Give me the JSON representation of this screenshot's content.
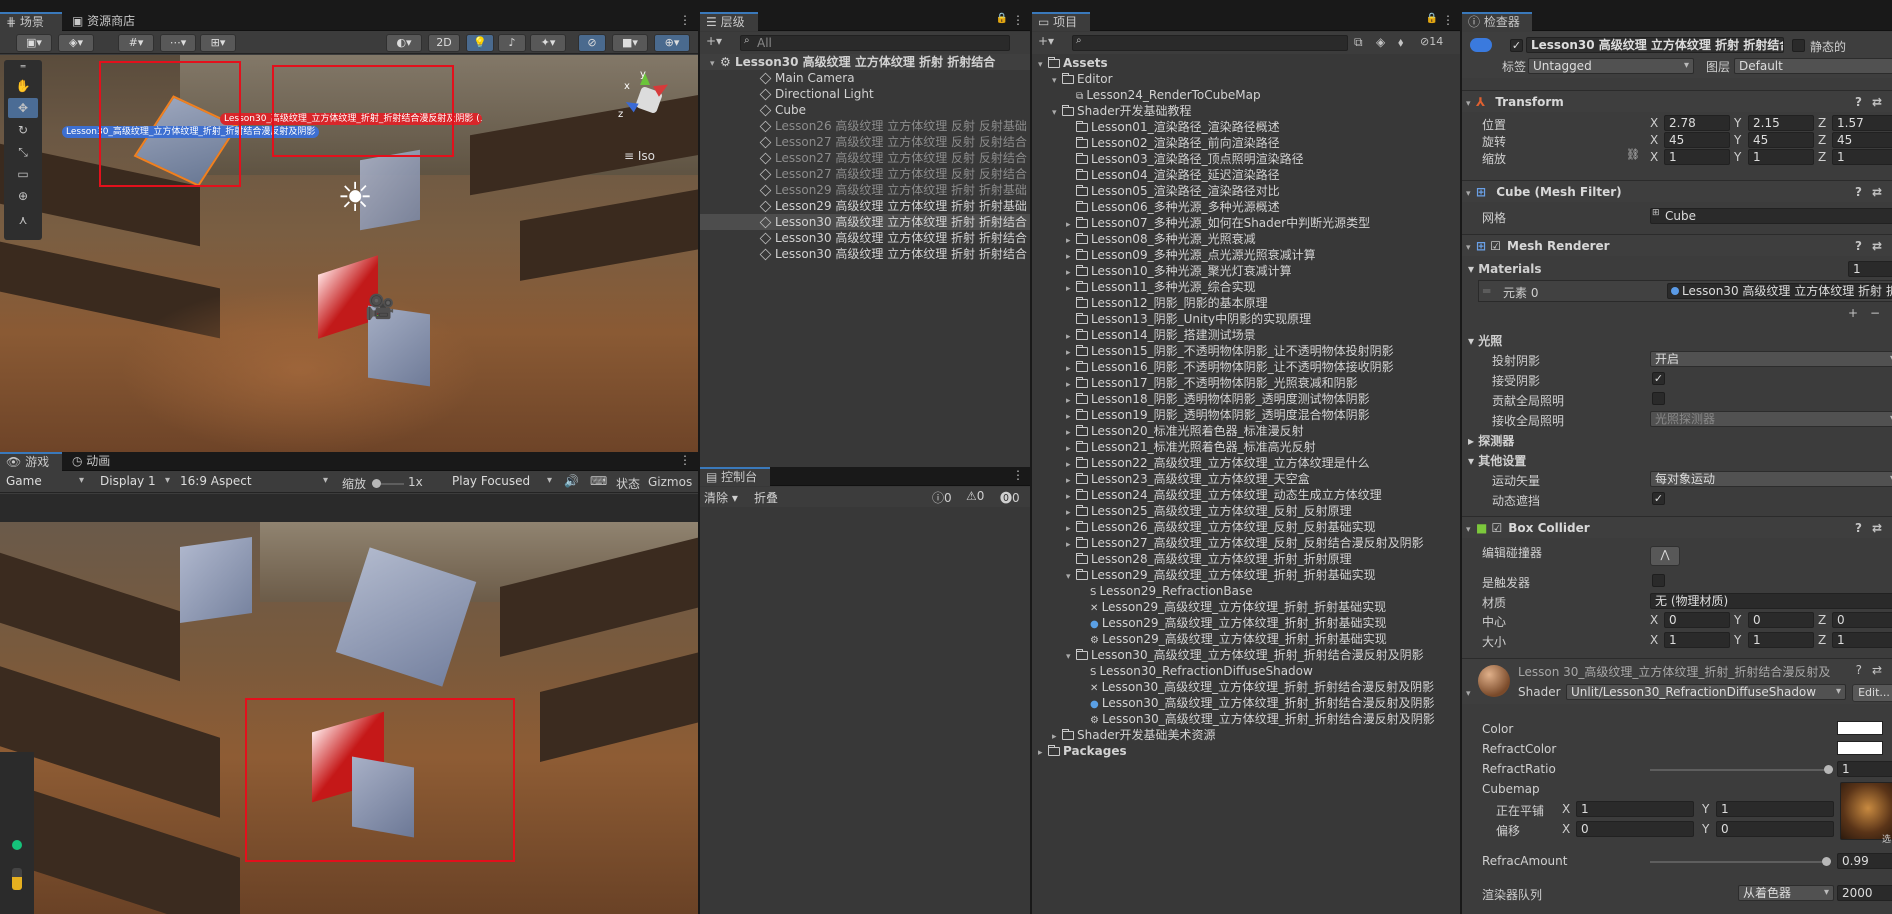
{
  "scene_panel": {
    "tabs": [
      {
        "label": "场景"
      },
      {
        "label": "资源商店"
      }
    ],
    "toggle_2d": "2D",
    "iso_label": "Iso",
    "object_label_1": "Lesson30_高级纹理_立方体纹理_折射_折射结合漫反射及阴影",
    "object_label_2": "Lesson30_高级纹理_立方体纹理_折射_折射结合漫反射及阴影 (1)"
  },
  "game_panel": {
    "tabs": [
      {
        "label": "游戏"
      },
      {
        "label": "动画"
      }
    ],
    "game_dropdown": "Game",
    "display_dropdown": "Display 1",
    "aspect_dropdown": "16:9 Aspect",
    "scale_label": "缩放",
    "scale_value": "1x",
    "play_mode": "Play Focused",
    "stats_label": "状态",
    "gizmos_label": "Gizmos"
  },
  "hierarchy": {
    "tab": "层级",
    "search_placeholder": "All",
    "scene_root": "Lesson30 高级纹理 立方体纹理 折射 折射结合",
    "items": [
      {
        "label": "Main Camera",
        "dim": false
      },
      {
        "label": "Directional Light",
        "dim": false
      },
      {
        "label": "Cube",
        "dim": false
      },
      {
        "label": "Lesson26 高级纹理 立方体纹理 反射 反射基础",
        "dim": true
      },
      {
        "label": "Lesson27 高级纹理 立方体纹理 反射 反射结合",
        "dim": true
      },
      {
        "label": "Lesson27 高级纹理 立方体纹理 反射 反射结合",
        "dim": true
      },
      {
        "label": "Lesson27 高级纹理 立方体纹理 反射 反射结合",
        "dim": true
      },
      {
        "label": "Lesson29 高级纹理 立方体纹理 折射 折射基础",
        "dim": true
      },
      {
        "label": "Lesson29 高级纹理 立方体纹理 折射 折射基础",
        "dim": false
      },
      {
        "label": "Lesson30 高级纹理 立方体纹理 折射 折射结合",
        "dim": false,
        "selected": true
      },
      {
        "label": "Lesson30 高级纹理 立方体纹理 折射 折射结合",
        "dim": false
      },
      {
        "label": "Lesson30 高级纹理 立方体纹理 折射 折射结合",
        "dim": false
      }
    ]
  },
  "console": {
    "tab": "控制台",
    "clear": "清除",
    "collapse": "折叠",
    "log_count": "0",
    "warn_count": "0",
    "error_count": "0"
  },
  "project": {
    "tab": "项目",
    "hidden_count": "14",
    "tree": [
      {
        "label": "Assets",
        "depth": 0,
        "arrow": "▾",
        "type": "folder",
        "bold": true
      },
      {
        "label": "Editor",
        "depth": 1,
        "arrow": "▾",
        "type": "folder"
      },
      {
        "label": "Lesson24_RenderToCubeMap",
        "depth": 2,
        "arrow": "",
        "type": "script"
      },
      {
        "label": "Shader开发基础教程",
        "depth": 1,
        "arrow": "▾",
        "type": "folder"
      },
      {
        "label": "Lesson01_渲染路径_渲染路径概述",
        "depth": 2,
        "arrow": "",
        "type": "folder"
      },
      {
        "label": "Lesson02_渲染路径_前向渲染路径",
        "depth": 2,
        "arrow": "",
        "type": "folder"
      },
      {
        "label": "Lesson03_渲染路径_顶点照明渲染路径",
        "depth": 2,
        "arrow": "",
        "type": "folder"
      },
      {
        "label": "Lesson04_渲染路径_延迟渲染路径",
        "depth": 2,
        "arrow": "",
        "type": "folder"
      },
      {
        "label": "Lesson05_渲染路径_渲染路径对比",
        "depth": 2,
        "arrow": "",
        "type": "folder"
      },
      {
        "label": "Lesson06_多种光源_多种光源概述",
        "depth": 2,
        "arrow": "",
        "type": "folder"
      },
      {
        "label": "Lesson07_多种光源_如何在Shader中判断光源类型",
        "depth": 2,
        "arrow": "▸",
        "type": "folder"
      },
      {
        "label": "Lesson08_多种光源_光照衰减",
        "depth": 2,
        "arrow": "▸",
        "type": "folder"
      },
      {
        "label": "Lesson09_多种光源_点光源光照衰减计算",
        "depth": 2,
        "arrow": "▸",
        "type": "folder"
      },
      {
        "label": "Lesson10_多种光源_聚光灯衰减计算",
        "depth": 2,
        "arrow": "▸",
        "type": "folder"
      },
      {
        "label": "Lesson11_多种光源_综合实现",
        "depth": 2,
        "arrow": "▸",
        "type": "folder"
      },
      {
        "label": "Lesson12_阴影_阴影的基本原理",
        "depth": 2,
        "arrow": "",
        "type": "folder"
      },
      {
        "label": "Lesson13_阴影_Unity中阴影的实现原理",
        "depth": 2,
        "arrow": "",
        "type": "folder"
      },
      {
        "label": "Lesson14_阴影_搭建测试场景",
        "depth": 2,
        "arrow": "▸",
        "type": "folder"
      },
      {
        "label": "Lesson15_阴影_不透明物体阴影_让不透明物体投射阴影",
        "depth": 2,
        "arrow": "▸",
        "type": "folder"
      },
      {
        "label": "Lesson16_阴影_不透明物体阴影_让不透明物体接收阴影",
        "depth": 2,
        "arrow": "▸",
        "type": "folder"
      },
      {
        "label": "Lesson17_阴影_不透明物体阴影_光照衰减和阴影",
        "depth": 2,
        "arrow": "▸",
        "type": "folder"
      },
      {
        "label": "Lesson18_阴影_透明物体阴影_透明度测试物体阴影",
        "depth": 2,
        "arrow": "▸",
        "type": "folder"
      },
      {
        "label": "Lesson19_阴影_透明物体阴影_透明度混合物体阴影",
        "depth": 2,
        "arrow": "▸",
        "type": "folder"
      },
      {
        "label": "Lesson20_标准光照着色器_标准漫反射",
        "depth": 2,
        "arrow": "▸",
        "type": "folder"
      },
      {
        "label": "Lesson21_标准光照着色器_标准高光反射",
        "depth": 2,
        "arrow": "▸",
        "type": "folder"
      },
      {
        "label": "Lesson22_高级纹理_立方体纹理_立方体纹理是什么",
        "depth": 2,
        "arrow": "▸",
        "type": "folder"
      },
      {
        "label": "Lesson23_高级纹理_立方体纹理_天空盒",
        "depth": 2,
        "arrow": "▸",
        "type": "folder"
      },
      {
        "label": "Lesson24_高级纹理_立方体纹理_动态生成立方体纹理",
        "depth": 2,
        "arrow": "▸",
        "type": "folder"
      },
      {
        "label": "Lesson25_高级纹理_立方体纹理_反射_反射原理",
        "depth": 2,
        "arrow": "▸",
        "type": "folder"
      },
      {
        "label": "Lesson26_高级纹理_立方体纹理_反射_反射基础实现",
        "depth": 2,
        "arrow": "▸",
        "type": "folder"
      },
      {
        "label": "Lesson27_高级纹理_立方体纹理_反射_反射结合漫反射及阴影",
        "depth": 2,
        "arrow": "▸",
        "type": "folder"
      },
      {
        "label": "Lesson28_高级纹理_立方体纹理_折射_折射原理",
        "depth": 2,
        "arrow": "",
        "type": "folder"
      },
      {
        "label": "Lesson29_高级纹理_立方体纹理_折射_折射基础实现",
        "depth": 2,
        "arrow": "▾",
        "type": "folder"
      },
      {
        "label": "Lesson29_RefractionBase",
        "depth": 3,
        "arrow": "",
        "type": "shader"
      },
      {
        "label": "Lesson29_高级纹理_立方体纹理_折射_折射基础实现",
        "depth": 3,
        "arrow": "",
        "type": "cubemap"
      },
      {
        "label": "Lesson29_高级纹理_立方体纹理_折射_折射基础实现",
        "depth": 3,
        "arrow": "",
        "type": "material"
      },
      {
        "label": "Lesson29_高级纹理_立方体纹理_折射_折射基础实现",
        "depth": 3,
        "arrow": "",
        "type": "scene"
      },
      {
        "label": "Lesson30_高级纹理_立方体纹理_折射_折射结合漫反射及阴影",
        "depth": 2,
        "arrow": "▾",
        "type": "folder"
      },
      {
        "label": "Lesson30_RefractionDiffuseShadow",
        "depth": 3,
        "arrow": "",
        "type": "shader"
      },
      {
        "label": "Lesson30_高级纹理_立方体纹理_折射_折射结合漫反射及阴影",
        "depth": 3,
        "arrow": "",
        "type": "cubemap"
      },
      {
        "label": "Lesson30_高级纹理_立方体纹理_折射_折射结合漫反射及阴影",
        "depth": 3,
        "arrow": "",
        "type": "material"
      },
      {
        "label": "Lesson30_高级纹理_立方体纹理_折射_折射结合漫反射及阴影",
        "depth": 3,
        "arrow": "",
        "type": "scene"
      },
      {
        "label": "Shader开发基础美术资源",
        "depth": 1,
        "arrow": "▸",
        "type": "folder"
      },
      {
        "label": "Packages",
        "depth": 0,
        "arrow": "▸",
        "type": "folder",
        "bold": true
      }
    ]
  },
  "inspector": {
    "tab": "检查器",
    "object_name": "Lesson30 高级纹理 立方体纹理 折射 折射结合漫反射",
    "static_label": "静态的",
    "tag_label": "标签",
    "tag_value": "Untagged",
    "layer_label": "图层",
    "layer_value": "Default",
    "transform": {
      "title": "Transform",
      "position_label": "位置",
      "position": [
        "2.78",
        "2.15",
        "1.57"
      ],
      "rotation_label": "旋转",
      "rotation": [
        "45",
        "45",
        "45"
      ],
      "scale_label": "缩放",
      "scale": [
        "1",
        "1",
        "1"
      ]
    },
    "mesh_filter": {
      "title": "Cube (Mesh Filter)",
      "mesh_label": "网格",
      "mesh_value": "Cube"
    },
    "mesh_renderer": {
      "title": "Mesh Renderer",
      "materials_label": "Materials",
      "materials_count": "1",
      "element_label": "元素 0",
      "element_value": "Lesson30 高级纹理 立方体纹理 折射 折",
      "lighting_label": "光照",
      "cast_shadows_label": "投射阴影",
      "cast_shadows_value": "开启",
      "receive_shadows_label": "接受阴影",
      "contribute_gi_label": "贡献全局照明",
      "receive_gi_label": "接收全局照明",
      "receive_gi_value": "光照探测器",
      "probes_label": "探测器",
      "additional_label": "其他设置",
      "motion_vectors_label": "运动矢量",
      "motion_vectors_value": "每对象运动",
      "dynamic_occlusion_label": "动态遮挡"
    },
    "box_collider": {
      "title": "Box Collider",
      "edit_label": "编辑碰撞器",
      "trigger_label": "是触发器",
      "material_label": "材质",
      "material_value": "无 (物理材质)",
      "center_label": "中心",
      "center": [
        "0",
        "0",
        "0"
      ],
      "size_label": "大小",
      "size": [
        "1",
        "1",
        "1"
      ]
    },
    "material": {
      "title": "Lesson 30_高级纹理_立方体纹理_折射_折射结合漫反射及",
      "shader_label": "Shader",
      "shader_value": "Unlit/Lesson30_RefractionDiffuseShadow",
      "edit_button": "Edit...",
      "color_label": "Color",
      "refract_color_label": "RefractColor",
      "refract_ratio_label": "RefractRatio",
      "refract_ratio_value": "1",
      "cubemap_label": "Cubemap",
      "tiling_label": "正在平铺",
      "tiling": [
        "1",
        "1"
      ],
      "offset_label": "偏移",
      "offset": [
        "0",
        "0"
      ],
      "select_label": "选",
      "refrac_amount_label": "RefracAmount",
      "refrac_amount_value": "0.99",
      "render_queue_label": "渲染器队列",
      "render_queue_mode": "从着色器",
      "render_queue_value": "2000"
    }
  }
}
